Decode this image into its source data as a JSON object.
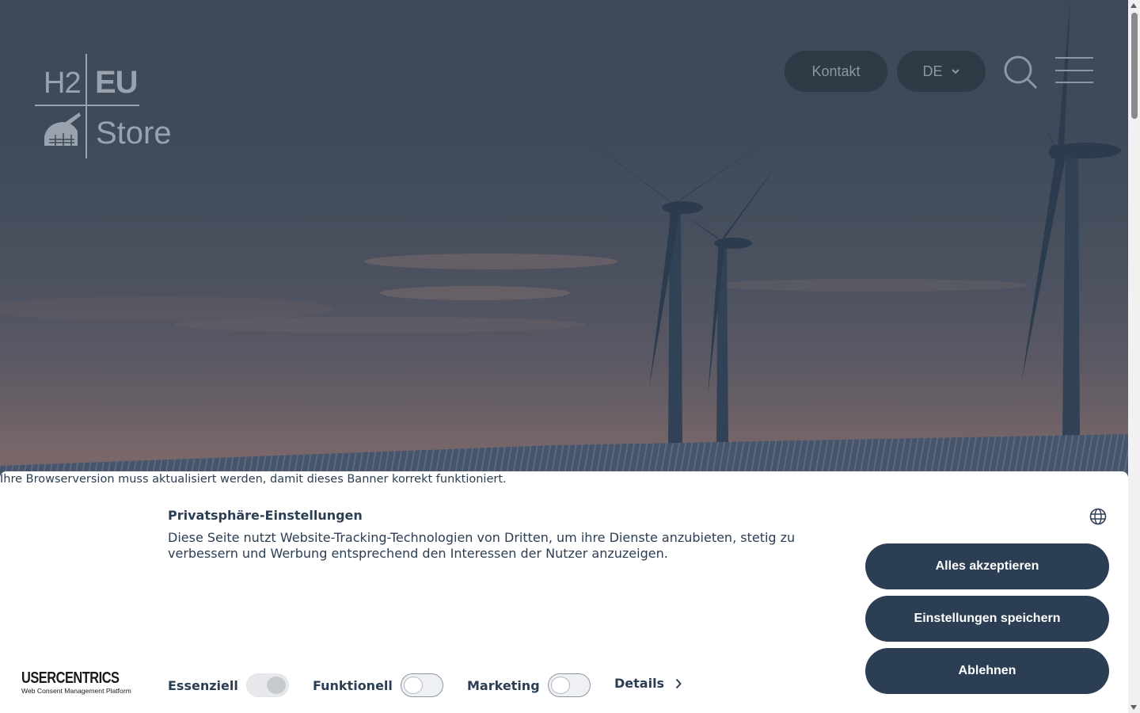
{
  "header": {
    "logo": {
      "h2": "H2",
      "eu": "EU",
      "store": "Store"
    },
    "contact_label": "Kontakt",
    "language": "DE",
    "icons": [
      "search-icon",
      "hamburger-menu-icon",
      "chevron-down-icon"
    ]
  },
  "banner": {
    "browser_note": "Ihre Browserversion muss aktualisiert werden, damit dieses Banner korrekt funktioniert.",
    "title": "Privatsphäre-Einstellungen",
    "description": "Diese Seite nutzt Website-Tracking-Technologien von Dritten, um ihre Dienste anzubieten, stetig zu verbessern und Werbung entsprechend den Interessen der Nutzer anzuzeigen.",
    "buttons": {
      "accept": "Alles akzeptieren",
      "save": "Einstellungen speichern",
      "deny": "Ablehnen"
    },
    "toggles": [
      {
        "label": "Essenziell",
        "state": "on-disabled"
      },
      {
        "label": "Funktionell",
        "state": "off"
      },
      {
        "label": "Marketing",
        "state": "off"
      }
    ],
    "details_label": "Details",
    "brand": {
      "name": "USERCENTRICS",
      "tagline": "Web Consent Management Platform"
    }
  },
  "colors": {
    "primary": "#2c3e53",
    "nav_pill": "#2f3a47",
    "muted": "#8d96a1"
  }
}
